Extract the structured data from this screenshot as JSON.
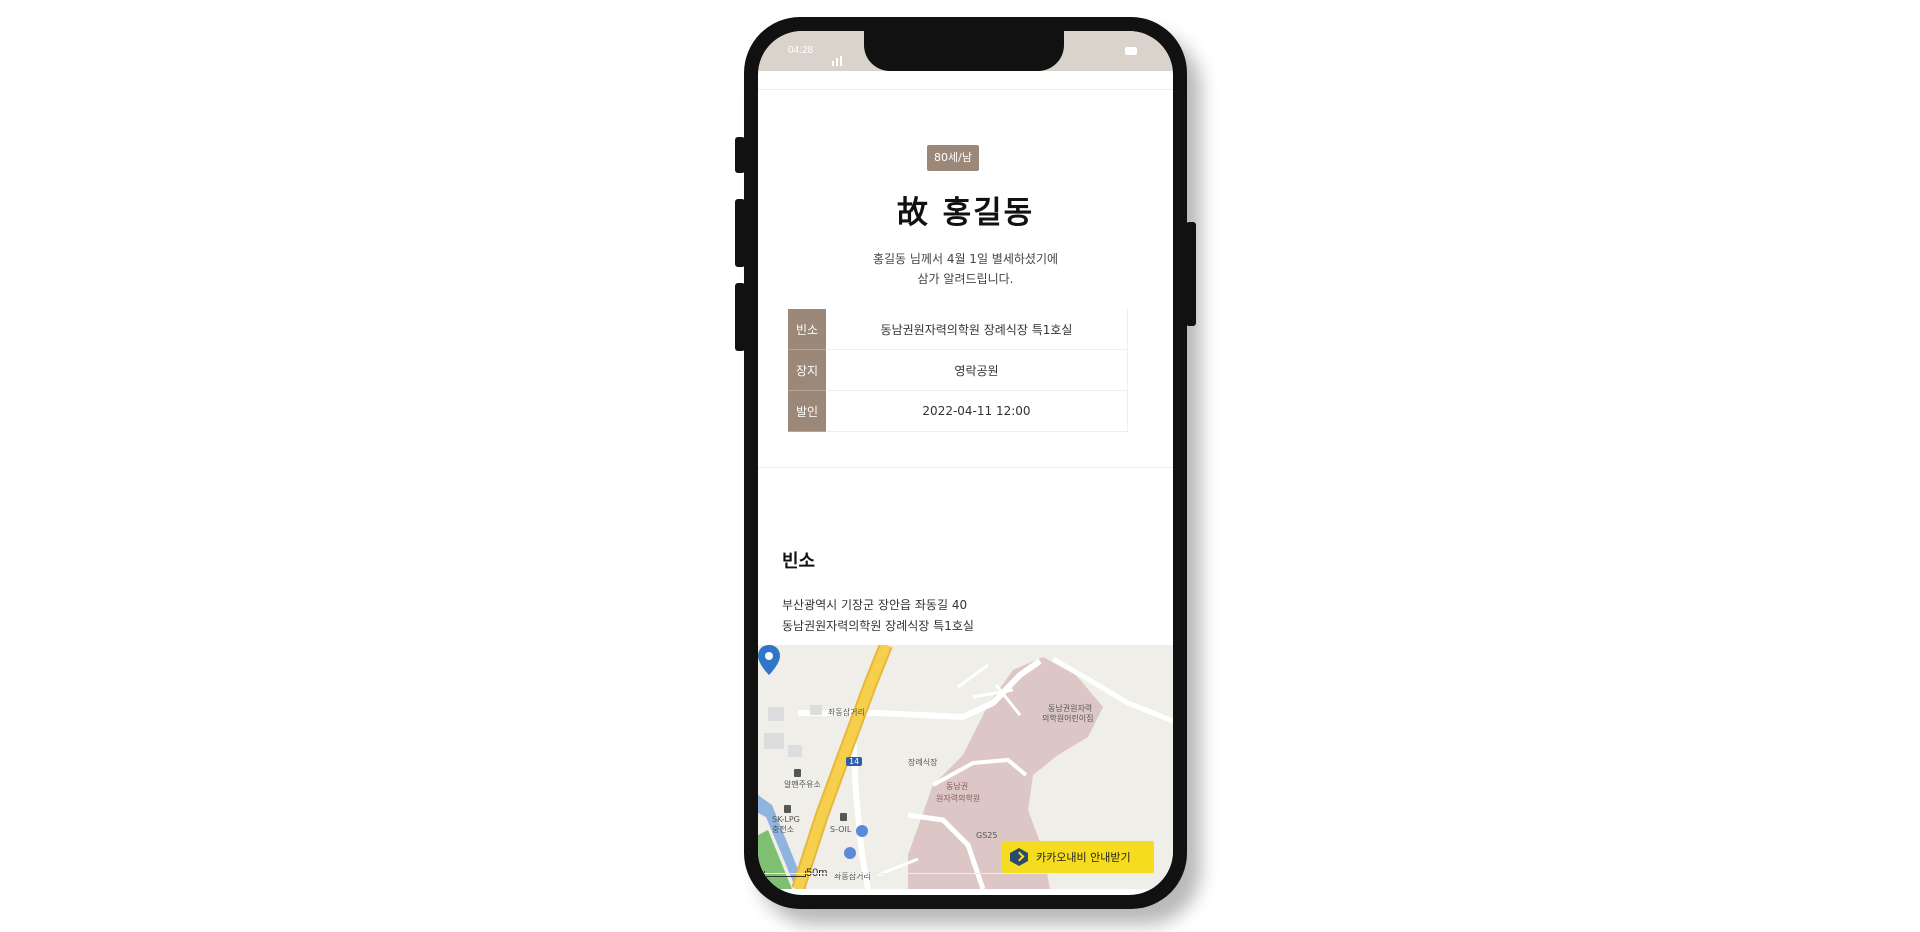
{
  "status_bar": {
    "time": "04:28"
  },
  "deceased": {
    "badge": "80세/남",
    "name": "故 홍길동",
    "notice_line1": "홍길동 님께서 4월 1일 별세하셨기에",
    "notice_line2": "삼가 알려드립니다."
  },
  "info_table": [
    {
      "label": "빈소",
      "value": "동남권원자력의학원 장례식장 특1호실"
    },
    {
      "label": "장지",
      "value": "영락공원"
    },
    {
      "label": "발인",
      "value": "2022-04-11 12:00"
    }
  ],
  "venue": {
    "title": "빈소",
    "address_line1": "부산광역시 기장군 장안읍 좌동길 40",
    "address_line2": "동남권원자력의학원 장례식장 특1호실"
  },
  "map": {
    "labels": {
      "intersection": "좌동삼거리",
      "road_number": "14",
      "gas_station": "알펜주유소",
      "lpg_station": "SK-LPG 충전소",
      "s_oil": "S-OIL",
      "funeral_hall": "장례식장",
      "hospital_line1": "동남권",
      "hospital_line2": "원자력의학원",
      "top_building_line1": "동남권원자력",
      "top_building_line2": "의학원어린이집",
      "convenience": "GS25",
      "bus_stop": "좌동삼거리"
    },
    "scale": "50m",
    "navi_button": "카카오내비 안내받기"
  },
  "colors": {
    "accent": "#9c8878",
    "status_bar": "#d9d3cc",
    "navi_button": "#f5dc1e"
  }
}
